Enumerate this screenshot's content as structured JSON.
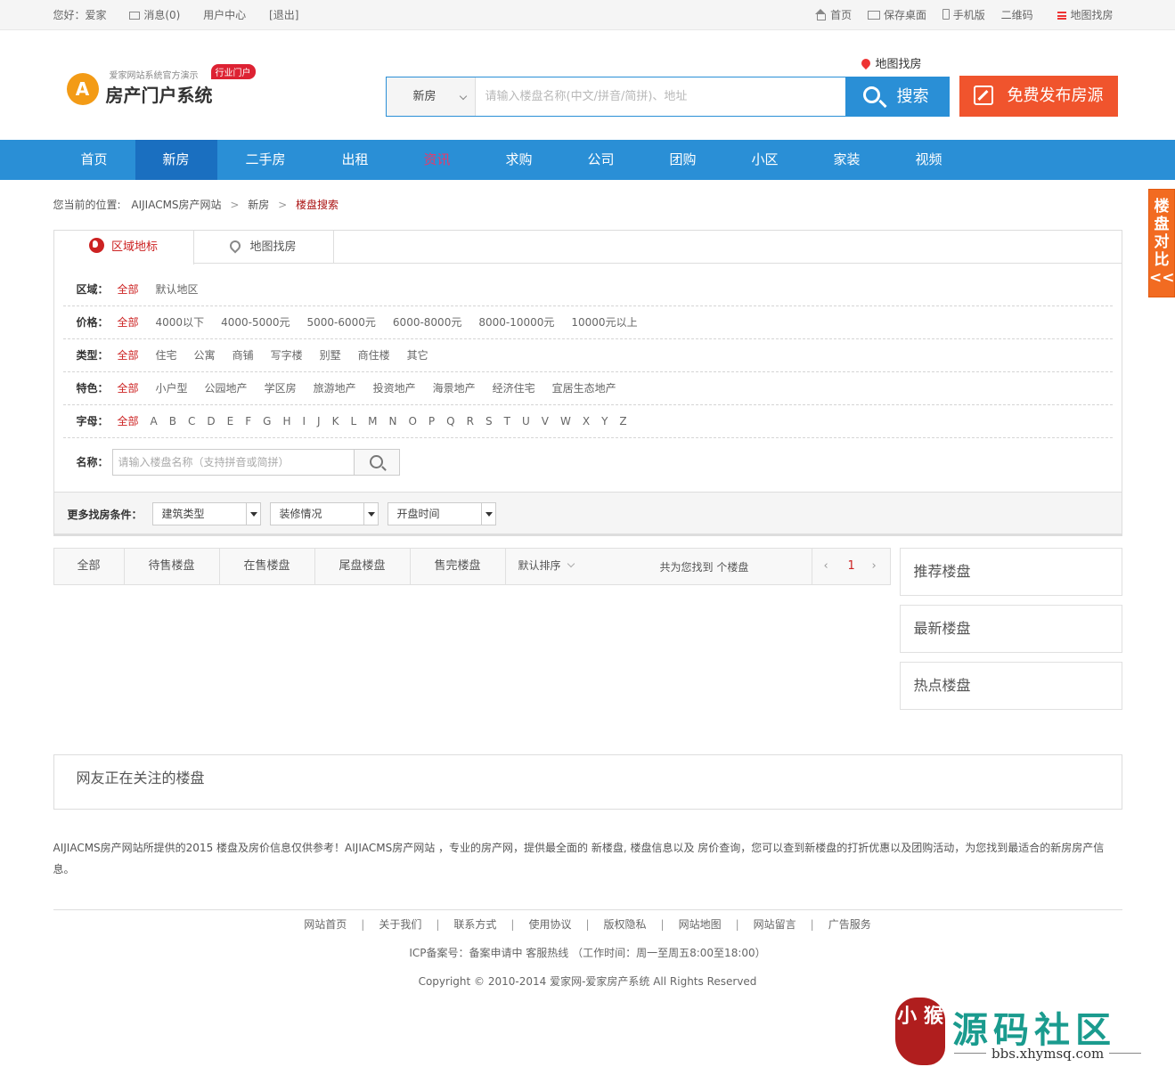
{
  "topbar": {
    "greeting": "您好：爱家",
    "messages": "消息(0)",
    "user_center": "用户中心",
    "logout": "[退出]",
    "home": "首页",
    "save_desktop": "保存桌面",
    "mobile": "手机版",
    "qrcode": "二维码",
    "map_search": "地图找房"
  },
  "header": {
    "logo_sub": "爱家网站系统官方演示",
    "logo_tag": "行业门户",
    "logo_name": "房产门户系统",
    "logo_badge": "A",
    "map_link": "地图找房",
    "search_type": "新房",
    "search_placeholder": "请输入楼盘名称(中文/拼音/简拼)、地址",
    "search_button": "搜索",
    "publish_button": "免费发布房源",
    "accent_color": "#2a8fd6",
    "publish_color": "#f0542d"
  },
  "nav": {
    "items": [
      "首页",
      "新房",
      "二手房",
      "出租",
      "资讯",
      "求购",
      "公司",
      "团购",
      "小区",
      "家装",
      "视频"
    ],
    "active": "新房"
  },
  "breadcrumb": {
    "prefix": "您当前的位置:",
    "site": "AIJIACMS房产网站",
    "section": "新房",
    "current": "楼盘搜索"
  },
  "filter": {
    "tabs": [
      "区域地标",
      "地图找房"
    ],
    "rows": [
      {
        "label": "区域：",
        "options": [
          "全部",
          "默认地区"
        ]
      },
      {
        "label": "价格：",
        "options": [
          "全部",
          "4000以下",
          "4000-5000元",
          "5000-6000元",
          "6000-8000元",
          "8000-10000元",
          "10000元以上"
        ]
      },
      {
        "label": "类型：",
        "options": [
          "全部",
          "住宅",
          "公寓",
          "商铺",
          "写字楼",
          "别墅",
          "商住楼",
          "其它"
        ]
      },
      {
        "label": "特色：",
        "options": [
          "全部",
          "小户型",
          "公园地产",
          "学区房",
          "旅游地产",
          "投资地产",
          "海景地产",
          "经济住宅",
          "宜居生态地产"
        ]
      },
      {
        "label": "字母：",
        "options": [
          "全部",
          "A",
          "B",
          "C",
          "D",
          "E",
          "F",
          "G",
          "H",
          "I",
          "J",
          "K",
          "L",
          "M",
          "N",
          "O",
          "P",
          "Q",
          "R",
          "S",
          "T",
          "U",
          "V",
          "W",
          "X",
          "Y",
          "Z"
        ]
      }
    ],
    "name_label": "名称：",
    "name_placeholder": "请输入楼盘名称（支持拼音或简拼）",
    "more_label": "更多找房条件：",
    "dropdowns": [
      "建筑类型",
      "装修情况",
      "开盘时间"
    ]
  },
  "list": {
    "status_tabs": [
      "全部",
      "待售楼盘",
      "在售楼盘",
      "尾盘楼盘",
      "售完楼盘"
    ],
    "sort": "默认排序",
    "found_text": "共为您找到 个楼盘",
    "page": "1",
    "prev": "‹",
    "next": "›"
  },
  "sidebar": {
    "boxes": [
      "推荐楼盘",
      "最新楼盘",
      "热点楼盘"
    ]
  },
  "attention_title": "网友正在关注的楼盘",
  "description": "AIJIACMS房产网站所提供的2015 楼盘及房价信息仅供参考！AIJIACMS房产网站 ，专业的房产网，提供最全面的 新楼盘, 楼盘信息以及 房价查询，您可以查到新楼盘的打折优惠以及团购活动，为您找到最适合的新房房产信息。",
  "footer": {
    "links": [
      "网站首页",
      "关于我们",
      "联系方式",
      "使用协议",
      "版权隐私",
      "网站地图",
      "网站留言",
      "广告服务"
    ],
    "icp": "ICP备案号：备案申请中 客服热线 （工作时间：周一至周五8:00至18:00）",
    "copyright": "Copyright © 2010-2014 爱家网-爱家房产系统 All Rights Reserved"
  },
  "compare": {
    "chars": [
      "楼",
      "盘",
      "对",
      "比",
      "<<"
    ]
  },
  "watermark": {
    "seal": "小 猴",
    "title": "源码社区",
    "url": "bbs.xhymsq.com"
  }
}
